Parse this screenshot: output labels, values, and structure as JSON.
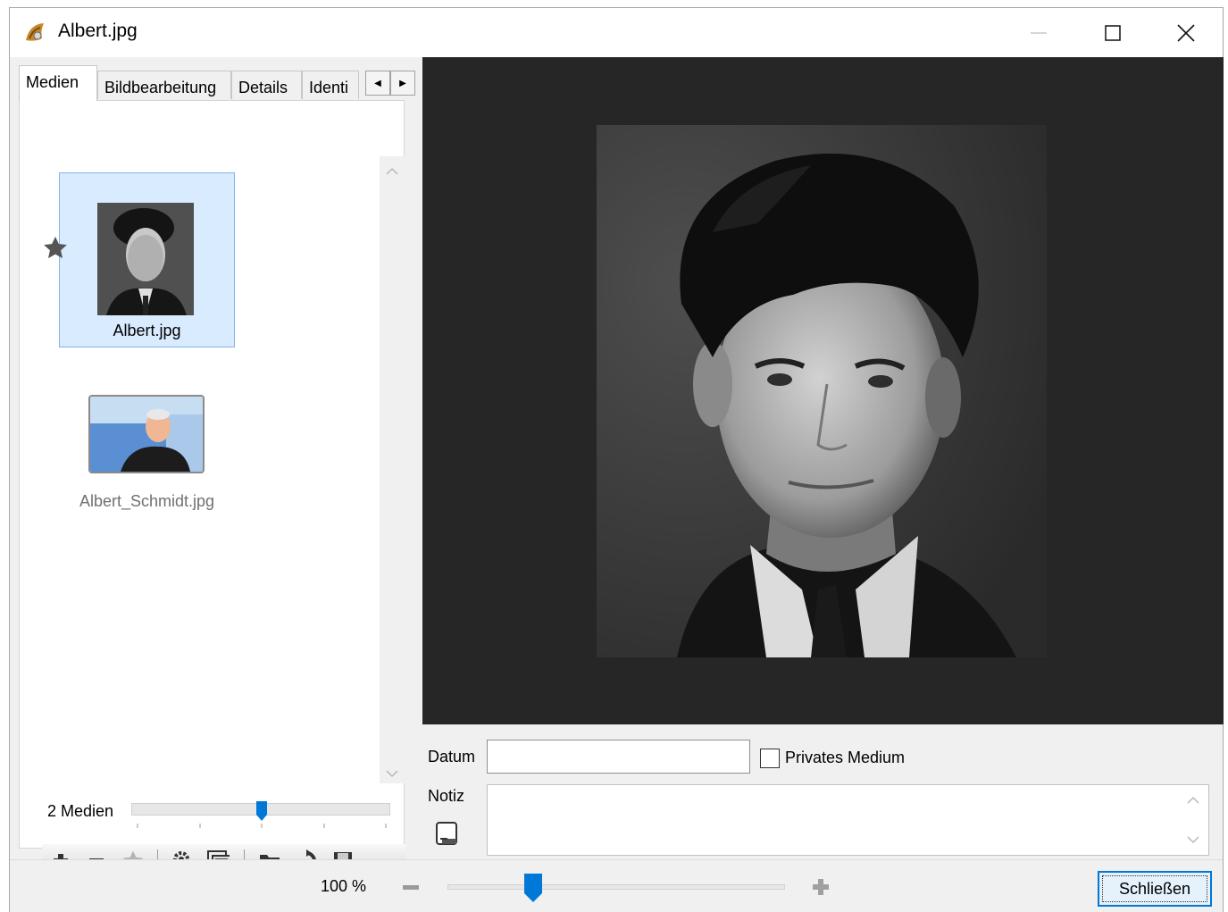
{
  "window": {
    "title": "Albert.jpg"
  },
  "tabs": [
    "Medien",
    "Bildbearbeitung",
    "Details",
    "Identi"
  ],
  "media": {
    "items": [
      {
        "label": "Albert.jpg",
        "selected": true,
        "favorite": true
      },
      {
        "label": "Albert_Schmidt.jpg",
        "selected": false,
        "favorite": false
      }
    ],
    "count_label": "2 Medien",
    "thumb_size_fraction": 0.5
  },
  "toolbar_icons": [
    "add-icon",
    "remove-icon",
    "star-icon",
    "settings-icon",
    "images-icon",
    "folder-open-icon",
    "refresh-icon",
    "save-icon"
  ],
  "fields": {
    "datum_label": "Datum",
    "datum_value": "",
    "private_label": "Privates Medium",
    "private_checked": false,
    "notiz_label": "Notiz",
    "notiz_value": ""
  },
  "zoom": {
    "label": "100 %",
    "fraction": 0.25
  },
  "buttons": {
    "close": "Schließen"
  },
  "colors": {
    "accent": "#0078d7",
    "viewer_bg": "#262626",
    "selection": "#d9ebff"
  }
}
